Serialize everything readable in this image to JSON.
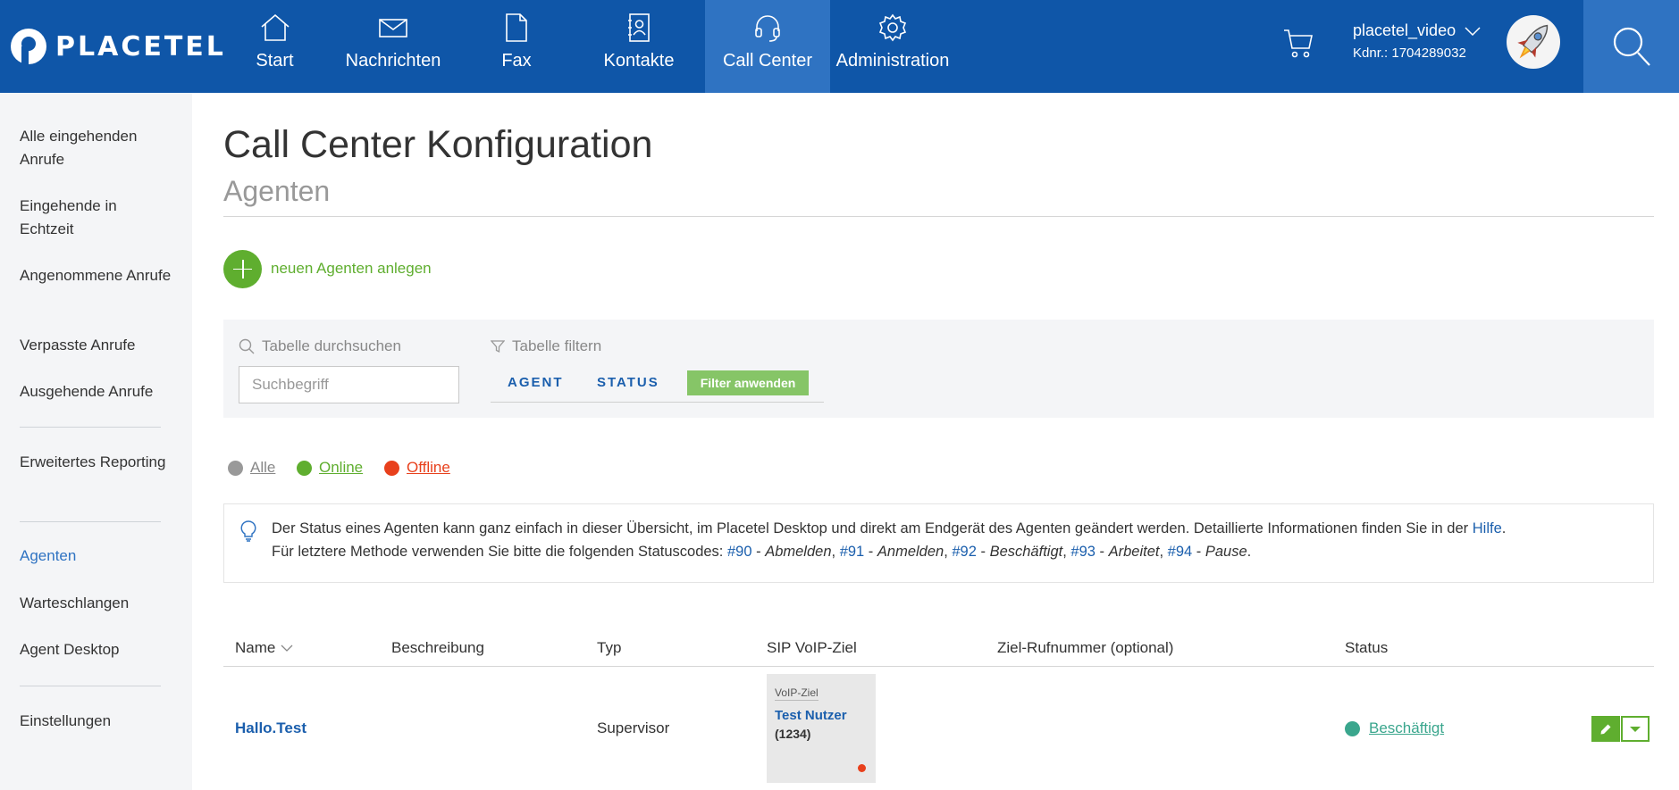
{
  "brand": {
    "name": "PLACETEL"
  },
  "nav": [
    {
      "label": "Start",
      "icon": "home-icon"
    },
    {
      "label": "Nachrichten",
      "icon": "envelope-icon"
    },
    {
      "label": "Fax",
      "icon": "document-icon"
    },
    {
      "label": "Kontakte",
      "icon": "contacts-icon"
    },
    {
      "label": "Call Center",
      "icon": "headset-icon",
      "active": true
    },
    {
      "label": "Administration",
      "icon": "gear-icon"
    }
  ],
  "account": {
    "username": "placetel_video",
    "customer_number": "Kdnr.: 1704289032"
  },
  "sidebar": {
    "items": [
      {
        "label": "Alle eingehenden Anrufe"
      },
      {
        "label": "Eingehende in Echtzeit"
      },
      {
        "label": "Angenommene Anrufe"
      },
      {
        "label": "Verpasste Anrufe"
      },
      {
        "label": "Ausgehende Anrufe"
      },
      {
        "label": "Erweitertes Reporting"
      },
      {
        "label": "Agenten",
        "active": true
      },
      {
        "label": "Warteschlangen"
      },
      {
        "label": "Agent Desktop"
      },
      {
        "label": "Einstellungen"
      }
    ]
  },
  "page": {
    "title": "Call Center Konfiguration",
    "subtitle": "Agenten"
  },
  "add_agent": {
    "label": "neuen Agenten anlegen"
  },
  "filter_panel": {
    "search_label": "Tabelle durchsuchen",
    "search_placeholder": "Suchbegriff",
    "search_value": "",
    "filter_label": "Tabelle filtern",
    "tabs": [
      "AGENT",
      "STATUS"
    ],
    "apply_label": "Filter anwenden"
  },
  "status_filters": [
    {
      "label": "Alle",
      "color": "#999999"
    },
    {
      "label": "Online",
      "color": "#5fae2f"
    },
    {
      "label": "Offline",
      "color": "#e8401c"
    }
  ],
  "info": {
    "line1_text": "Der Status eines Agenten kann ganz einfach in dieser Übersicht, im Placetel Desktop und direkt am Endgerät des Agenten geändert werden. Detaillierte Informationen finden Sie in der",
    "line1_link": "Hilfe",
    "line2_prefix": "Für letztere Methode verwenden Sie bitte die folgenden Statuscodes:",
    "codes": [
      {
        "code": "#90",
        "meaning": "Abmelden"
      },
      {
        "code": "#91",
        "meaning": "Anmelden"
      },
      {
        "code": "#92",
        "meaning": "Beschäftigt"
      },
      {
        "code": "#93",
        "meaning": "Arbeitet"
      },
      {
        "code": "#94",
        "meaning": "Pause"
      }
    ]
  },
  "table": {
    "columns": [
      "Name",
      "Beschreibung",
      "Typ",
      "SIP VoIP-Ziel",
      "Ziel-Rufnummer (optional)",
      "Status"
    ],
    "rows": [
      {
        "name": "Hallo.Test",
        "description": "",
        "type": "Supervisor",
        "voip_kind": "VoIP-Ziel",
        "voip_user": "Test Nutzer",
        "voip_ext": "(1234)",
        "target_number": "",
        "status": "Beschäftigt",
        "status_color": "#3aa68d"
      }
    ]
  },
  "colors": {
    "header": "#0f56a8",
    "header_active": "#2f73c2",
    "accent_green": "#5fae2f",
    "link_blue": "#1b5fad"
  }
}
